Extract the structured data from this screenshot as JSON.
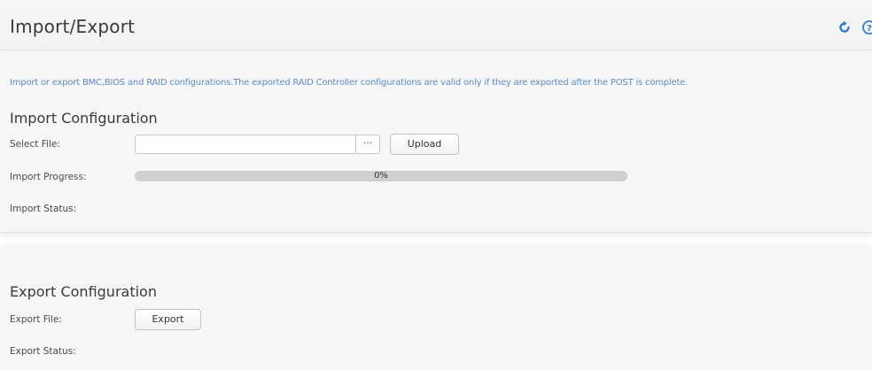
{
  "header": {
    "title": "Import/Export",
    "icons": [
      "refresh-icon",
      "help-icon"
    ]
  },
  "description": "Import or export BMC,BIOS and RAID configurations.The exported RAID Controller configurations are valid only if they are exported after the POST is complete.",
  "import": {
    "title": "Import Configuration",
    "select_file_label": "Select File:",
    "file_value": "",
    "browse_label": "···",
    "upload_label": "Upload",
    "progress_label": "Import Progress:",
    "progress_value": 0,
    "progress_text": "0%",
    "status_label": "Import Status:"
  },
  "export": {
    "title": "Export Configuration",
    "file_label": "Export File:",
    "export_label": "Export",
    "status_label": "Export Status:"
  },
  "colors": {
    "accent": "#5b8dc8",
    "header_icon": "#2f7ec9"
  }
}
